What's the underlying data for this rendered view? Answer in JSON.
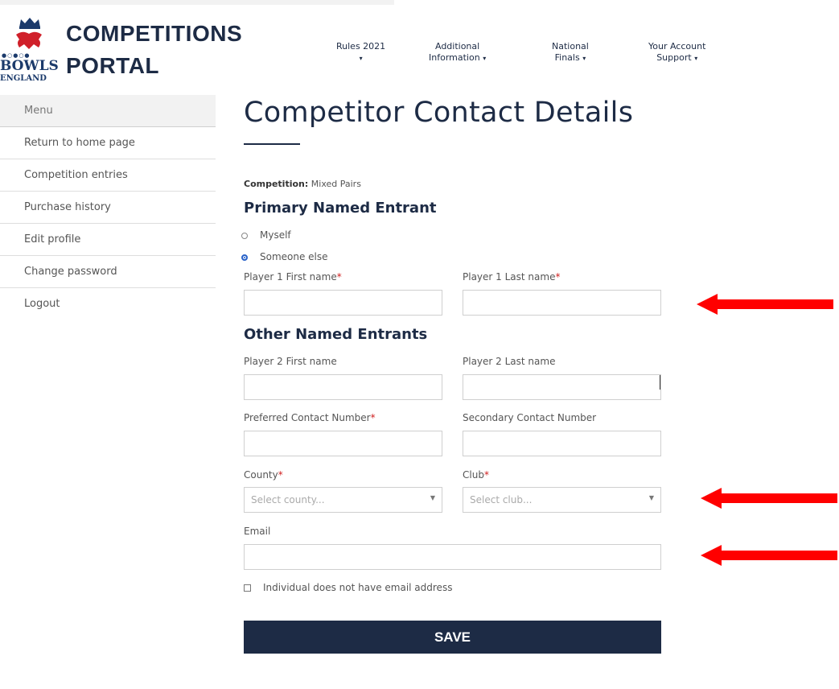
{
  "colors": {
    "brand": "#1d2b45",
    "accent_red": "#ff0000",
    "radio_blue": "#2a63c9"
  },
  "logo": {
    "name": "crown-lion-logo-icon",
    "line1": "BOWLS",
    "line2": "ENGLAND"
  },
  "header": {
    "title_line1": "COMPETITIONS",
    "title_line2": "PORTAL"
  },
  "nav": [
    {
      "line1": "Rules 2021",
      "line2": "",
      "caret": "▾"
    },
    {
      "line1": "Additional",
      "line2": "Information",
      "caret": "▾"
    },
    {
      "line1": "National",
      "line2": "Finals",
      "caret": "▾"
    },
    {
      "line1": "Your Account",
      "line2": "Support",
      "caret": "▾"
    }
  ],
  "sidebar": {
    "items": [
      {
        "label": "Menu"
      },
      {
        "label": "Return to home page"
      },
      {
        "label": "Competition entries"
      },
      {
        "label": "Purchase history"
      },
      {
        "label": "Edit profile"
      },
      {
        "label": "Change password"
      },
      {
        "label": "Logout"
      }
    ]
  },
  "main": {
    "title": "Competitor Contact Details",
    "competition_label": "Competition:",
    "competition_value": "Mixed Pairs",
    "primary_heading": "Primary Named Entrant",
    "radio_myself": "Myself",
    "radio_someone": "Someone else",
    "selected_radio": "Someone else",
    "p1_first_label": "Player 1 First name",
    "p1_last_label": "Player 1 Last name",
    "required_mark": "*",
    "other_heading": "Other Named Entrants",
    "p2_first_label": "Player 2 First name",
    "p2_last_label": "Player 2 Last name",
    "pref_contact_label": "Preferred Contact Number",
    "sec_contact_label": "Secondary Contact Number",
    "county_label": "County",
    "county_placeholder": "Select county...",
    "club_label": "Club",
    "club_placeholder": "Select club...",
    "email_label": "Email",
    "no_email_label": "Individual does not have email address",
    "save_label": "SAVE"
  },
  "annotations": {
    "arrow_icon": "red-arrow-left-icon",
    "count": 3
  }
}
